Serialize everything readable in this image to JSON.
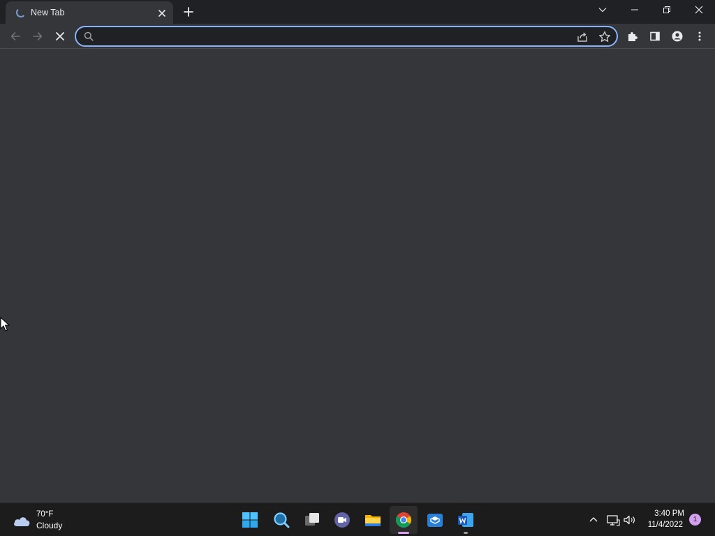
{
  "browser": {
    "tab": {
      "title": "New Tab",
      "loading": true
    },
    "omnibox": {
      "value": "",
      "placeholder": ""
    },
    "accent_color": "#8ab4f8",
    "toolbar_icons": [
      "back-arrow-icon",
      "forward-arrow-icon",
      "stop-loading-icon",
      "search-icon",
      "share-icon",
      "bookmark-star-icon",
      "extensions-puzzle-icon",
      "side-panel-icon",
      "profile-icon",
      "more-menu-icon"
    ],
    "window_icons": [
      "tab-search-chevron-icon",
      "minimize-icon",
      "restore-icon",
      "close-icon"
    ]
  },
  "taskbar": {
    "weather": {
      "temperature": "70°F",
      "condition": "Cloudy"
    },
    "apps": [
      "windows-start-icon",
      "search-icon",
      "task-view-icon",
      "teams-chat-icon",
      "file-explorer-icon",
      "chrome-icon",
      "microsoft-store-icon",
      "word-icon"
    ],
    "active_app": "chrome-icon",
    "tray_icons": [
      "show-hidden-icons-chevron",
      "network-icon",
      "volume-icon"
    ],
    "clock": {
      "time": "3:40 PM",
      "date": "11/4/2022"
    },
    "notifications": "1",
    "indicator_color": "#d6a0f0"
  }
}
